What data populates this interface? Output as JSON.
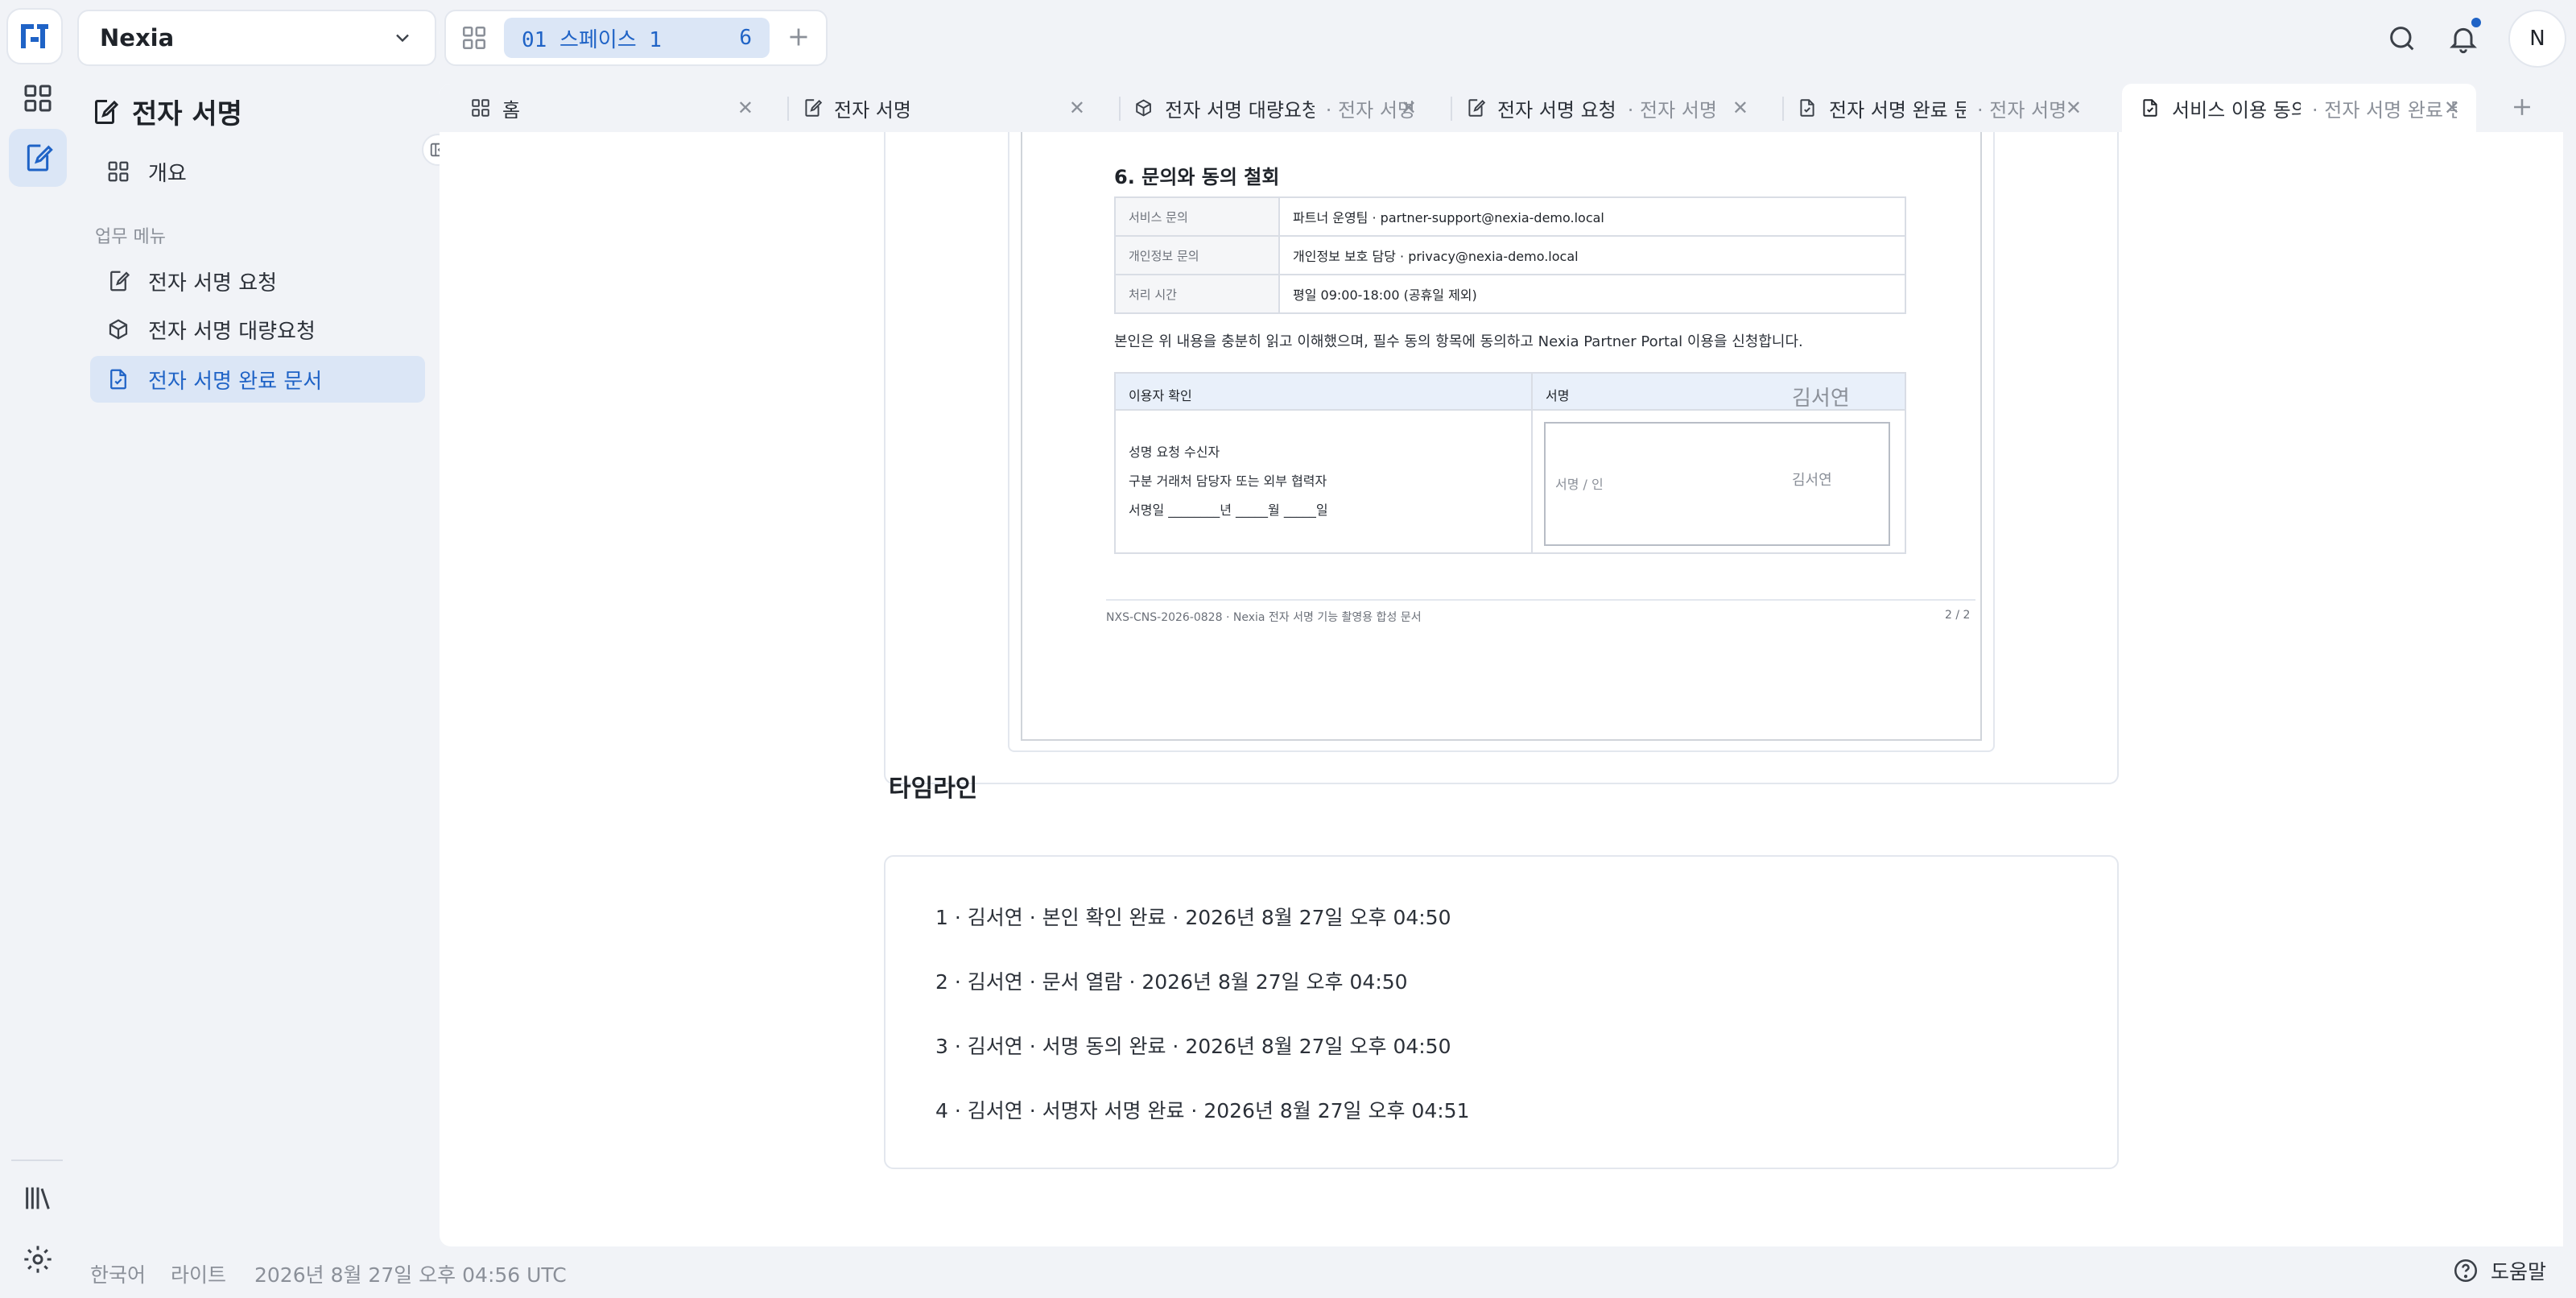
{
  "app": {
    "workspace_name": "Nexia",
    "space": {
      "label": "01 스페이스 1",
      "count": "6"
    },
    "user_initial": "N"
  },
  "sidebar": {
    "title": "전자 서명",
    "overview": "개요",
    "section": "업무 메뉴",
    "items": [
      {
        "label": "전자 서명 요청"
      },
      {
        "label": "전자 서명 대량요청"
      },
      {
        "label": "전자 서명 완료 문서"
      }
    ]
  },
  "tabs": [
    {
      "title": "홈",
      "sub": ""
    },
    {
      "title": "전자 서명",
      "sub": ""
    },
    {
      "title": "전자 서명 대량요청",
      "sub": "· 전자 서명"
    },
    {
      "title": "전자 서명 요청",
      "sub": "· 전자 서명"
    },
    {
      "title": "전자 서명 완료 문",
      "sub": "· 전자 서명"
    },
    {
      "title": "서비스 이용 동의서",
      "sub": "· 전자 서명 완료 문"
    }
  ],
  "document": {
    "heading": "6. 문의와 동의 철회",
    "rows": [
      {
        "k": "서비스 문의",
        "v": "파트너 운영팀 · partner-support@nexia-demo.local"
      },
      {
        "k": "개인정보 문의",
        "v": "개인정보 보호 담당 · privacy@nexia-demo.local"
      },
      {
        "k": "처리 시간",
        "v": "평일 09:00-18:00 (공휴일 제외)"
      }
    ],
    "consent": "본인은 위 내용을 충분히 읽고 이해했으며, 필수 동의 항목에 동의하고 Nexia Partner Portal 이용을 신청합니다.",
    "signer_header": "이용자 확인",
    "sign_header": "서명",
    "signer_name_big": "김서연",
    "signer_name_small": "김서연",
    "name_line": "성명   요청 수신자",
    "type_line": "구분   거래처 담당자 또는 외부 협력자",
    "date_line": "서명일   ________년 _____월 _____일",
    "sign_placeholder": "서명 / 인",
    "footer_left": "NXS-CNS-2026-0828 · Nexia 전자 서명 기능 촬영용 합성 문서",
    "footer_right": "2 / 2"
  },
  "timeline": {
    "title": "타임라인",
    "items": [
      "1  ·  김서연  ·  본인 확인 완료  ·  2026년 8월 27일 오후 04:50",
      "2  ·  김서연  ·  문서 열람  ·  2026년 8월 27일 오후 04:50",
      "3  ·  김서연  ·  서명 동의 완료  ·  2026년 8월 27일 오후 04:50",
      "4  ·  김서연  ·  서명자 서명 완료  ·  2026년 8월 27일 오후 04:51"
    ]
  },
  "status_bar": {
    "language": "한국어",
    "theme": "라이트",
    "datetime": "2026년 8월 27일 오후 04:56 UTC",
    "help": "도움말"
  },
  "colors": {
    "accent": "#1f63c6",
    "active_bg": "#dbe6f6"
  },
  "icons": [
    "grid-icon",
    "sign-doc-icon",
    "search-icon",
    "bell-icon",
    "library-icon",
    "gear-icon",
    "help-icon",
    "box-icon",
    "close-icon",
    "plus-icon",
    "chevron-down-icon",
    "panel-collapse-icon"
  ]
}
